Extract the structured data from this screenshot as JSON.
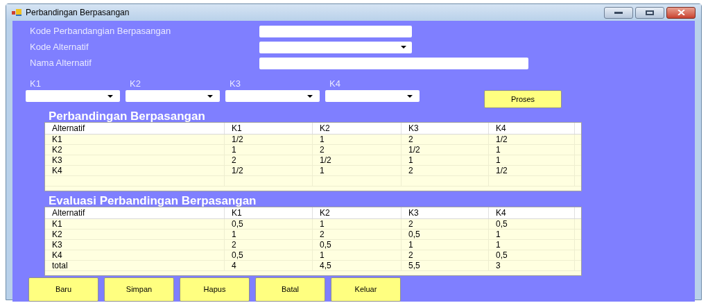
{
  "window": {
    "title": "Perbandingan Berpasangan"
  },
  "fields": [
    {
      "label": "Kode Perbandangian Berpasangan",
      "kind": "text"
    },
    {
      "label": "Kode Alternatif",
      "kind": "combo"
    },
    {
      "label": "Nama Alternatif",
      "kind": "text"
    }
  ],
  "criteria": [
    {
      "label": "K1"
    },
    {
      "label": "K2"
    },
    {
      "label": "K3"
    },
    {
      "label": "K4"
    }
  ],
  "process_button": "Proses",
  "tables": [
    {
      "title": "Perbandingan Berpasangan",
      "columns": [
        "Alternatif",
        "K1",
        "K2",
        "K3",
        "K4"
      ],
      "rows": [
        [
          "K1",
          "1/2",
          "1",
          "2",
          "1/2"
        ],
        [
          "K2",
          "1",
          "2",
          "1/2",
          "1"
        ],
        [
          "K3",
          "2",
          "1/2",
          "1",
          "1"
        ],
        [
          "K4",
          "1/2",
          "1",
          "2",
          "1/2"
        ]
      ]
    },
    {
      "title": "Evaluasi Perbandingan Berpasangan",
      "columns": [
        "Alternatif",
        "K1",
        "K2",
        "K3",
        "K4"
      ],
      "rows": [
        [
          "K1",
          "0,5",
          "1",
          "2",
          "0,5"
        ],
        [
          "K2",
          "1",
          "2",
          "0,5",
          "1"
        ],
        [
          "K3",
          "2",
          "0,5",
          "1",
          "1"
        ],
        [
          "K4",
          "0,5",
          "1",
          "2",
          "0,5"
        ],
        [
          "total",
          "4",
          "4,5",
          "5,5",
          "3"
        ]
      ]
    }
  ],
  "buttons": [
    "Baru",
    "Simpan",
    "Hapus",
    "Batal",
    "Keluar"
  ]
}
